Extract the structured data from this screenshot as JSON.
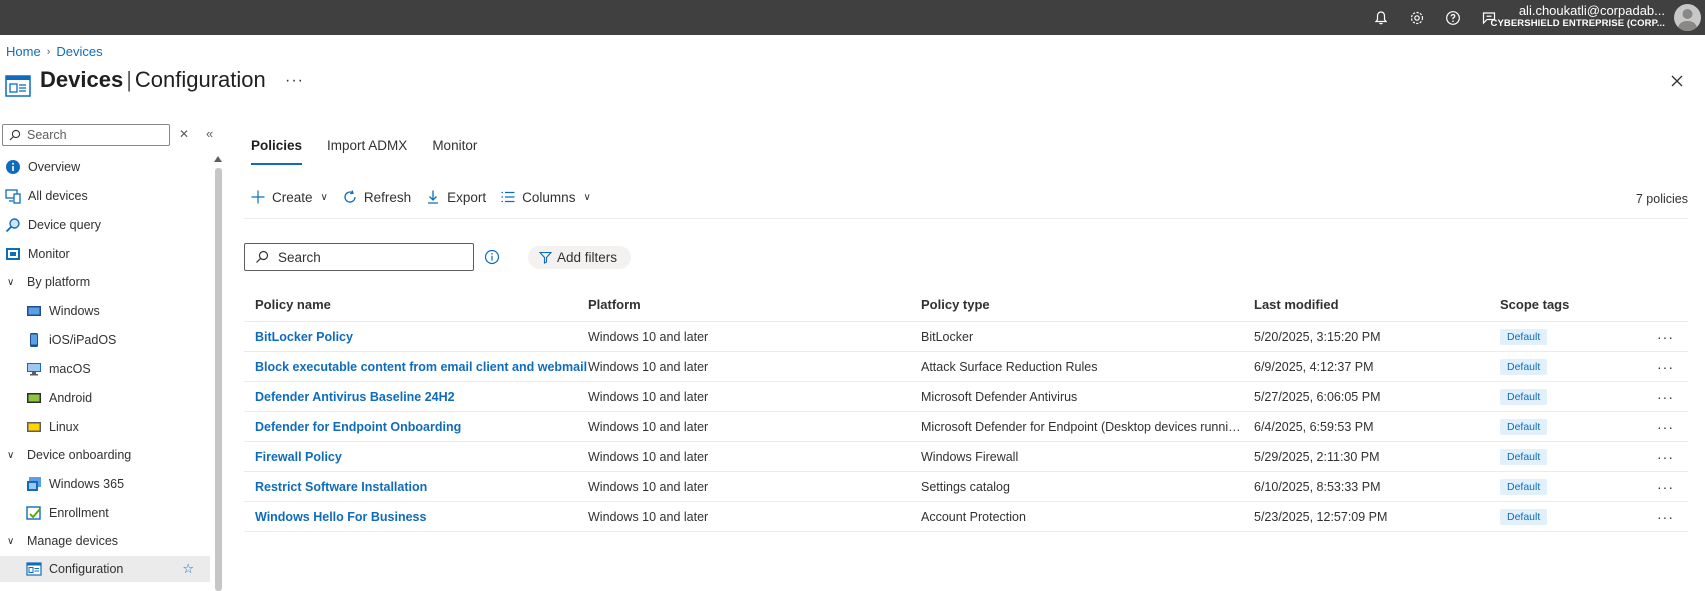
{
  "user": {
    "email": "ali.choukatli@corpadab...",
    "tenant": "CYBERSHIELD ENTREPRISE (CORP..."
  },
  "breadcrumb": {
    "home": "Home",
    "devices": "Devices"
  },
  "title": {
    "main": "Devices",
    "separator": "|",
    "sub": "Configuration",
    "more": "···"
  },
  "sidebar": {
    "search_placeholder": "Search",
    "items": {
      "overview": "Overview",
      "all_devices": "All devices",
      "device_query": "Device query",
      "monitor": "Monitor",
      "by_platform": "By platform",
      "windows": "Windows",
      "ios": "iOS/iPadOS",
      "macos": "macOS",
      "android": "Android",
      "linux": "Linux",
      "device_onboarding": "Device onboarding",
      "windows365": "Windows 365",
      "enrollment": "Enrollment",
      "manage_devices": "Manage devices",
      "configuration": "Configuration"
    }
  },
  "tabs": {
    "policies": "Policies",
    "import_admx": "Import ADMX",
    "monitor": "Monitor"
  },
  "toolbar": {
    "create": "Create",
    "refresh": "Refresh",
    "export": "Export",
    "columns": "Columns",
    "count": "7 policies"
  },
  "filter": {
    "search_placeholder": "Search",
    "add_filters": "Add filters"
  },
  "table": {
    "headers": {
      "name": "Policy name",
      "platform": "Platform",
      "type": "Policy type",
      "modified": "Last modified",
      "scope": "Scope tags"
    },
    "rows": [
      {
        "name": "BitLocker Policy",
        "platform": "Windows 10 and later",
        "type": "BitLocker",
        "modified": "5/20/2025, 3:15:20 PM",
        "scope": "Default"
      },
      {
        "name": "Block executable content from email client and webmail",
        "platform": "Windows 10 and later",
        "type": "Attack Surface Reduction Rules",
        "modified": "6/9/2025, 4:12:37 PM",
        "scope": "Default"
      },
      {
        "name": "Defender Antivirus Baseline 24H2",
        "platform": "Windows 10 and later",
        "type": "Microsoft Defender Antivirus",
        "modified": "5/27/2025, 6:06:05 PM",
        "scope": "Default"
      },
      {
        "name": "Defender for Endpoint Onboarding",
        "platform": "Windows 10 and later",
        "type": "Microsoft Defender for Endpoint (Desktop devices running ...",
        "modified": "6/4/2025, 6:59:53 PM",
        "scope": "Default"
      },
      {
        "name": "Firewall Policy",
        "platform": "Windows 10 and later",
        "type": "Windows Firewall",
        "modified": "5/29/2025, 2:11:30 PM",
        "scope": "Default"
      },
      {
        "name": "Restrict Software Installation",
        "platform": "Windows 10 and later",
        "type": "Settings catalog",
        "modified": "6/10/2025, 8:53:33 PM",
        "scope": "Default"
      },
      {
        "name": "Windows Hello For Business",
        "platform": "Windows 10 and later",
        "type": "Account Protection",
        "modified": "5/23/2025, 12:57:09 PM",
        "scope": "Default"
      }
    ],
    "row_more": "···"
  },
  "colors": {
    "accent": "#0f6cbd",
    "topbar": "#404040",
    "tag_bg": "#e1f0fa"
  }
}
